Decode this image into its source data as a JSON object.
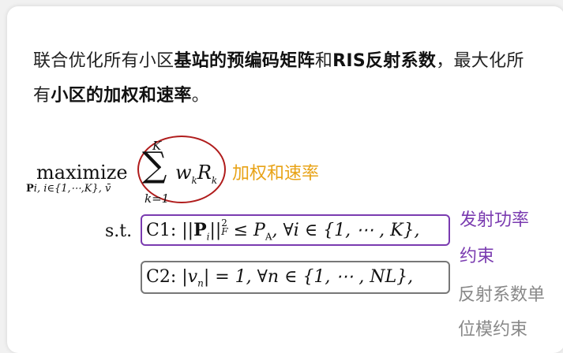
{
  "paragraph": {
    "part1": "联合优化所有小区",
    "bold1": "基站的预编码矩阵",
    "part2": "和",
    "bold2": "RIS反射系数",
    "part3": "，最大化所有",
    "bold3": "小区的加权和速率",
    "part4": "。"
  },
  "formula": {
    "maximize": "maximize",
    "max_subscript": "P",
    "max_subscript_rest": "i, i∈{1,⋯,K}, v̄",
    "sum_top": "K",
    "sum_symbol": "∑",
    "sum_bottom": "k=1",
    "objective_w": "w",
    "objective_k1": "k",
    "objective_R": "R",
    "objective_k2": "k",
    "st": "s.t.",
    "c1_label": "C1:",
    "c1_expr_a": "||",
    "c1_P": "P",
    "c1_expr_b": "i",
    "c1_expr_c": "||",
    "c1_sup": "2",
    "c1_subF": "F",
    "c1_expr_d": " ≤ ",
    "c1_PA": "P",
    "c1_A": "A",
    "c1_expr_e": ", ∀i ∈ {1, ⋯ , K},",
    "c2_label": "C2:",
    "c2_expr_a": "|v",
    "c2_n": "n",
    "c2_expr_b": "|  = 1, ∀n ∈ {1, ⋯ , NL},"
  },
  "annotations": {
    "objective": "加权和速率",
    "c1_line1": "发射功率",
    "c1_line2": "约束",
    "c2_line1": "反射系数单",
    "c2_line2": "位模约束"
  },
  "colors": {
    "objective_note": "#e8a317",
    "c1_note": "#7a3bb0",
    "c2_note": "#888888",
    "circle": "#b01c1c",
    "c1_box": "#7a3bb0",
    "c2_box": "#777777"
  }
}
